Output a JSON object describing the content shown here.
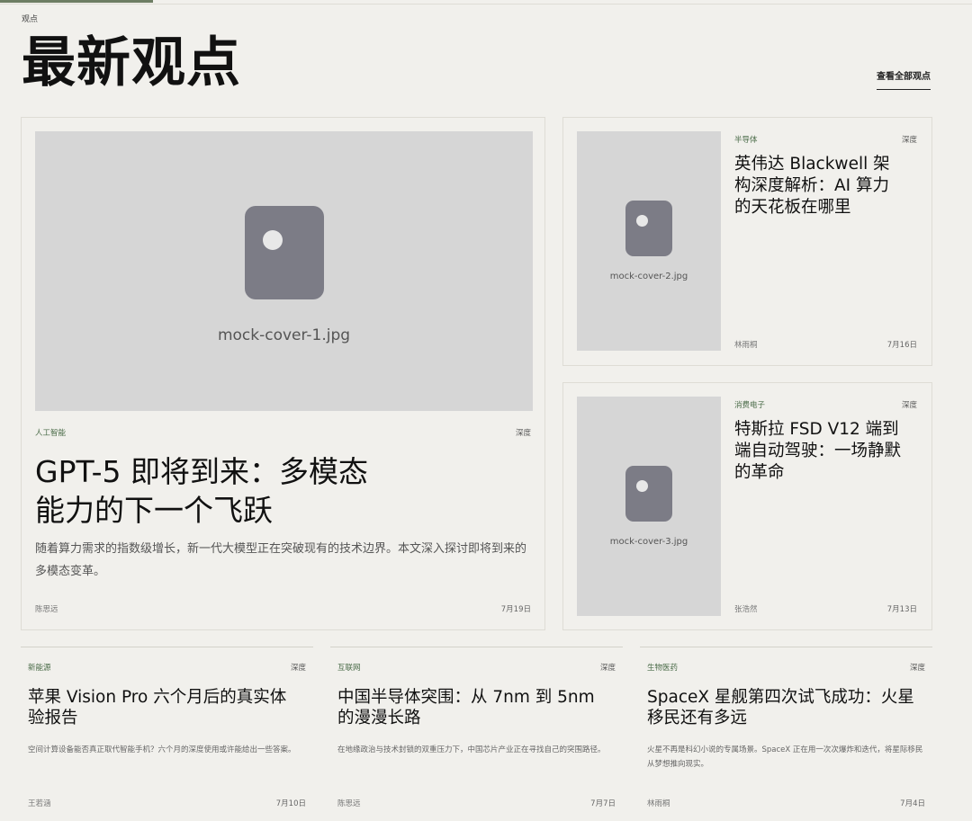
{
  "section_label": "观点",
  "page_title": "最新观点",
  "view_all_label": "查看全部观点",
  "featured": {
    "image_name": "mock-cover-1.jpg",
    "tag": "人工智能",
    "kind": "深度",
    "title": "GPT-5 即将到来：多模态能力的下一个飞跃",
    "summary": "随着算力需求的指数级增长，新一代大模型正在突破现有的技术边界。本文深入探讨即将到来的多模态变革。",
    "author": "陈思远",
    "date": "7月19日"
  },
  "side": [
    {
      "image_name": "mock-cover-2.jpg",
      "tag": "半导体",
      "kind": "深度",
      "title": "英伟达 Blackwell 架构深度解析：AI 算力的天花板在哪里",
      "author": "林雨桐",
      "date": "7月16日"
    },
    {
      "image_name": "mock-cover-3.jpg",
      "tag": "消费电子",
      "kind": "深度",
      "title": "特斯拉 FSD V12 端到端自动驾驶：一场静默的革命",
      "author": "张浩然",
      "date": "7月13日"
    }
  ],
  "bottom": [
    {
      "tag": "新能源",
      "kind": "深度",
      "title": "苹果 Vision Pro 六个月后的真实体验报告",
      "summary": "空间计算设备能否真正取代智能手机？六个月的深度使用或许能给出一些答案。",
      "author": "王若涵",
      "date": "7月10日"
    },
    {
      "tag": "互联网",
      "kind": "深度",
      "title": "中国半导体突围：从 7nm 到 5nm 的漫漫长路",
      "summary": "在地缘政治与技术封锁的双重压力下，中国芯片产业正在寻找自己的突围路径。",
      "author": "陈思远",
      "date": "7月7日"
    },
    {
      "tag": "生物医药",
      "kind": "深度",
      "title": "SpaceX 星舰第四次试飞成功：火星移民还有多远",
      "summary": "火星不再是科幻小说的专属场景。SpaceX 正在用一次次爆炸和迭代，将星际移民从梦想推向现实。",
      "author": "林雨桐",
      "date": "7月4日"
    }
  ],
  "colors": {
    "background": "#f1f0ec",
    "tag_green": "#4a6b48",
    "placeholder": "#d6d6d6",
    "glyph": "#7c7c86"
  }
}
